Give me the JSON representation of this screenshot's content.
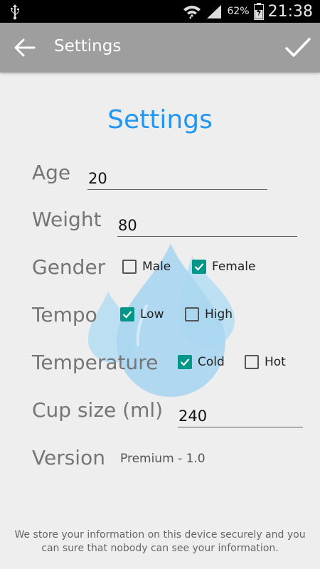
{
  "status_bar": {
    "battery_percent": "62%",
    "time": "21:38",
    "icons": [
      "usb-icon",
      "wifi-icon",
      "signal-icon",
      "battery-icon"
    ]
  },
  "toolbar": {
    "title": "Settings",
    "back_icon": "arrow-back-icon",
    "confirm_icon": "check-icon",
    "background": "#9e9e9e"
  },
  "form": {
    "heading": "Settings",
    "heading_color": "#2196f3",
    "age": {
      "label": "Age",
      "value": "20"
    },
    "weight": {
      "label": "Weight",
      "value": "80"
    },
    "gender": {
      "label": "Gender",
      "options": [
        {
          "label": "Male",
          "checked": false
        },
        {
          "label": "Female",
          "checked": true
        }
      ]
    },
    "tempo": {
      "label": "Tempo",
      "options": [
        {
          "label": "Low",
          "checked": true
        },
        {
          "label": "High",
          "checked": false
        }
      ]
    },
    "temperature": {
      "label": "Temperature",
      "options": [
        {
          "label": "Cold",
          "checked": true
        },
        {
          "label": "Hot",
          "checked": false
        }
      ]
    },
    "cup_size": {
      "label": "Cup size (ml)",
      "value": "240"
    },
    "version": {
      "label": "Version",
      "value": "Premium - 1.0"
    },
    "checkbox_color": "#009688"
  },
  "footer": {
    "text": "We store your information on this device securely and you can sure that nobody can see your information."
  }
}
